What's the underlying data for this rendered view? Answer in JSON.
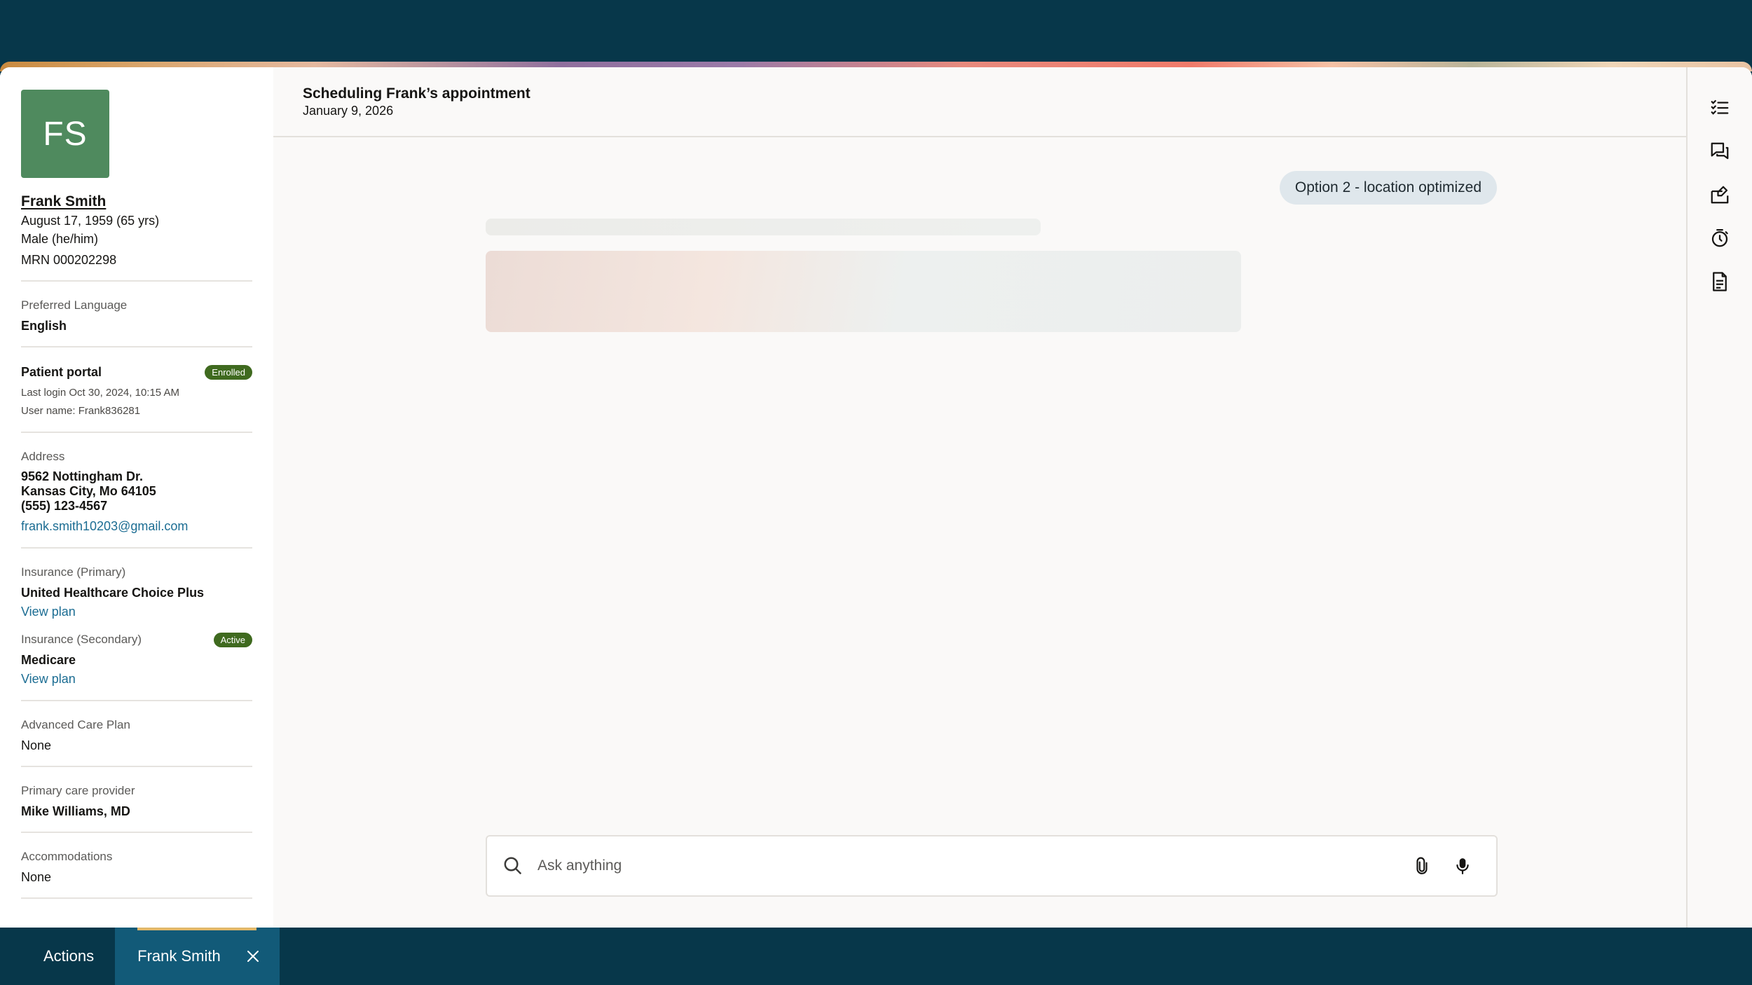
{
  "patient": {
    "initials": "FS",
    "name": "Frank Smith",
    "dob": "August 17, 1959 (65 yrs)",
    "gender": "Male (he/him)",
    "mrn": "MRN 000202298",
    "preferred_language_label": "Preferred Language",
    "preferred_language": "English",
    "portal": {
      "label": "Patient portal",
      "status": "Enrolled",
      "last_login": "Last login Oct 30, 2024, 10:15 AM",
      "username": "User name: Frank836281"
    },
    "address": {
      "label": "Address",
      "line1": "9562 Nottingham Dr.",
      "line2": "Kansas City, Mo 64105",
      "phone": "(555) 123-4567",
      "email": "frank.smith10203@gmail.com"
    },
    "insurance_primary": {
      "label": "Insurance (Primary)",
      "plan": "United Healthcare Choice Plus",
      "link": "View plan"
    },
    "insurance_secondary": {
      "label": "Insurance (Secondary)",
      "status": "Active",
      "plan": "Medicare",
      "link": "View plan"
    },
    "advanced_care_plan": {
      "label": "Advanced Care Plan",
      "value": "None"
    },
    "primary_care_provider": {
      "label": "Primary care provider",
      "value": "Mike Williams, MD"
    },
    "accommodations": {
      "label": "Accommodations",
      "value": "None"
    }
  },
  "header": {
    "title": "Scheduling Frank’s appointment",
    "date": "January 9, 2026"
  },
  "chat": {
    "user_message": "Option 2 - location optimized"
  },
  "search": {
    "placeholder": "Ask anything"
  },
  "rightbar": {
    "icons": [
      "checklist-icon",
      "chat-icon",
      "edit-calendar-icon",
      "timer-icon",
      "document-icon"
    ]
  },
  "taskbar": {
    "actions_label": "Actions",
    "tab_label": "Frank Smith"
  },
  "colors": {
    "background": "#07374a",
    "avatar": "#4f8a5e",
    "badge": "#3f6a1f",
    "link": "#1c6d93",
    "active_tab": "#125a78"
  }
}
